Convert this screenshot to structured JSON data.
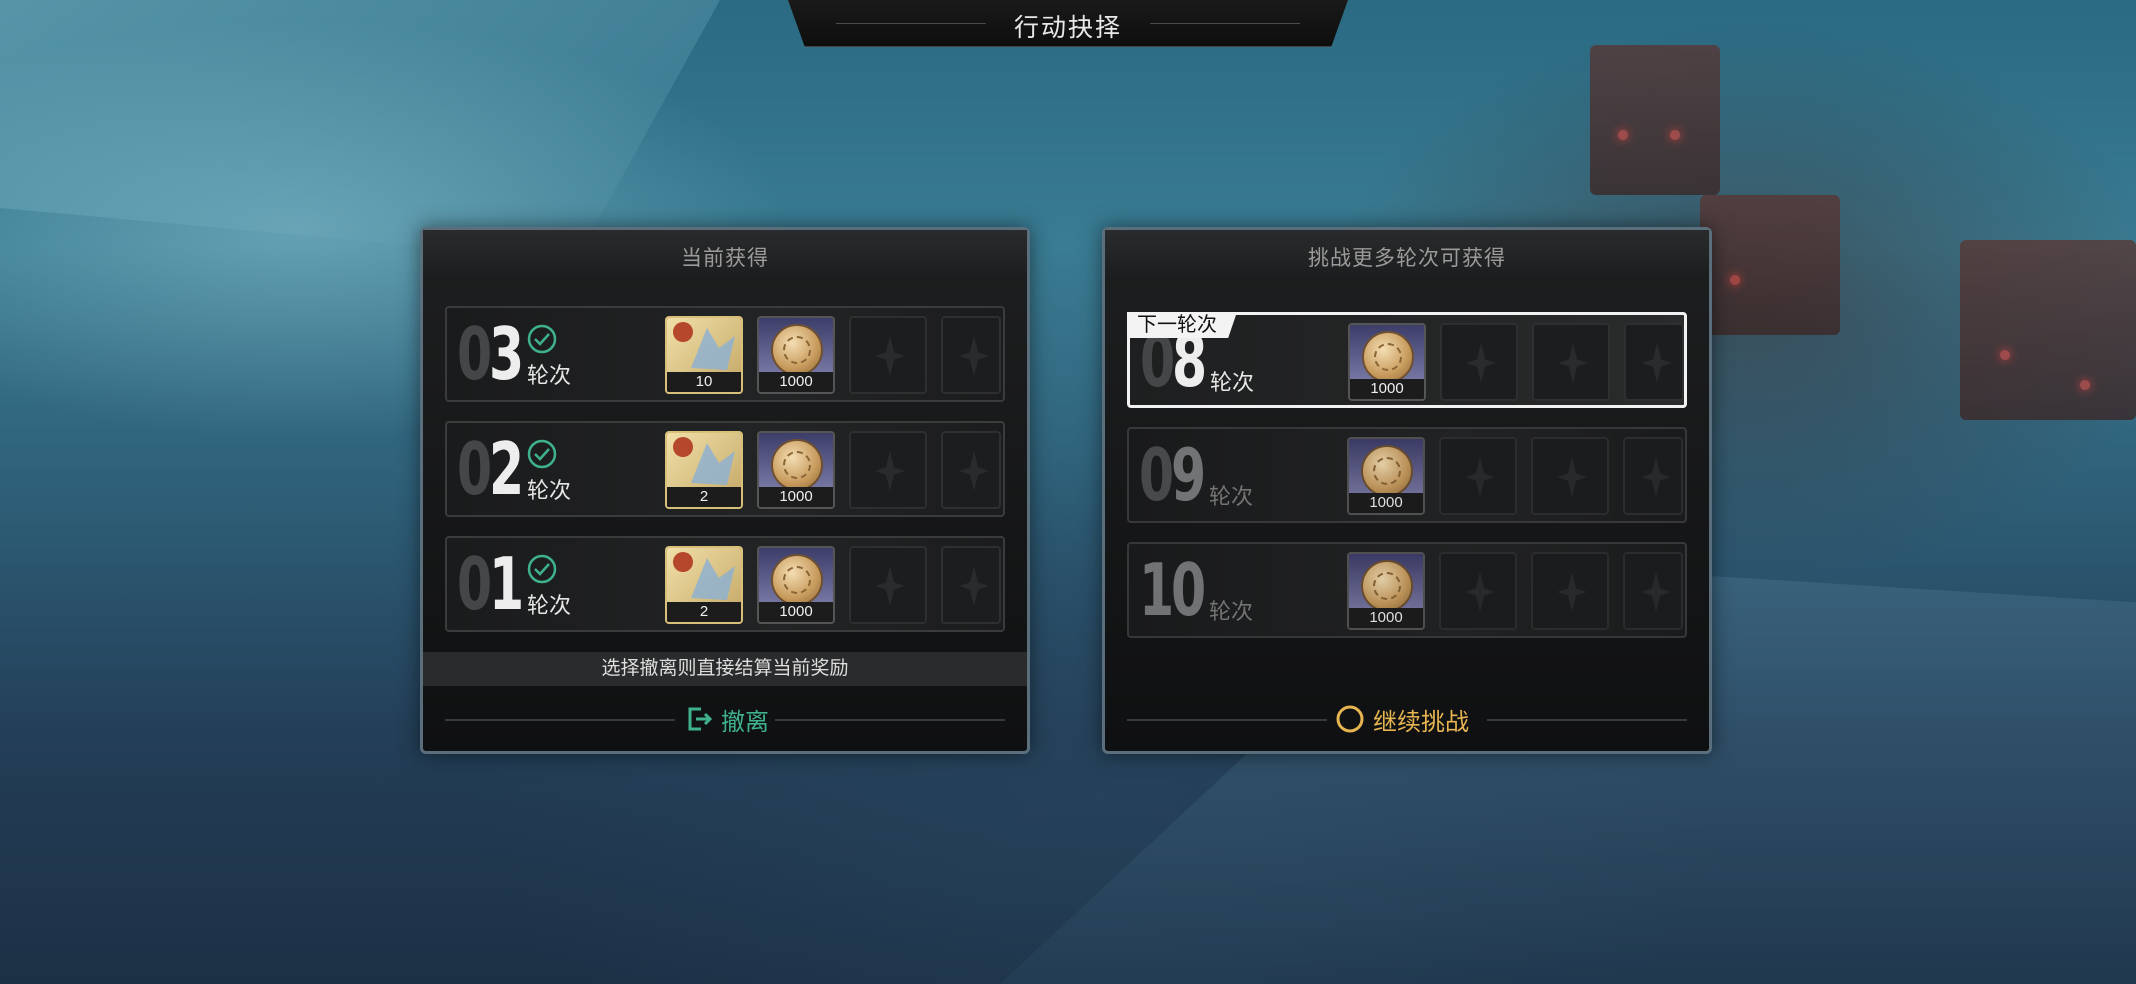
{
  "title": "行动抉择",
  "left_panel": {
    "header": "当前获得",
    "rows": [
      {
        "num_dim": "0",
        "num_lit": "3",
        "label": "轮次",
        "items": [
          {
            "icon": "chip-icon",
            "qty": "10"
          },
          {
            "icon": "coin-icon",
            "qty": "1000"
          }
        ]
      },
      {
        "num_dim": "0",
        "num_lit": "2",
        "label": "轮次",
        "items": [
          {
            "icon": "chip-icon",
            "qty": "2"
          },
          {
            "icon": "coin-icon",
            "qty": "1000"
          }
        ]
      },
      {
        "num_dim": "0",
        "num_lit": "1",
        "label": "轮次",
        "items": [
          {
            "icon": "chip-icon",
            "qty": "2"
          },
          {
            "icon": "coin-icon",
            "qty": "1000"
          }
        ]
      }
    ],
    "note": "选择撤离则直接结算当前奖励",
    "action": "撤离",
    "action_color": "#3fb28d"
  },
  "right_panel": {
    "header": "挑战更多轮次可获得",
    "rows": [
      {
        "tag": "下一轮次",
        "num_dim": "0",
        "num_lit": "8",
        "label": "轮次",
        "items": [
          {
            "icon": "coin-icon",
            "qty": "1000"
          }
        ]
      },
      {
        "num_dim": "0",
        "num_lit": "9",
        "label": "轮次",
        "items": [
          {
            "icon": "coin-icon",
            "qty": "1000"
          }
        ]
      },
      {
        "num_dim": "1",
        "num_lit": "0",
        "label": "轮次",
        "items": [
          {
            "icon": "coin-icon",
            "qty": "1000"
          }
        ]
      }
    ],
    "action": "继续挑战",
    "action_color": "#e6b552"
  }
}
